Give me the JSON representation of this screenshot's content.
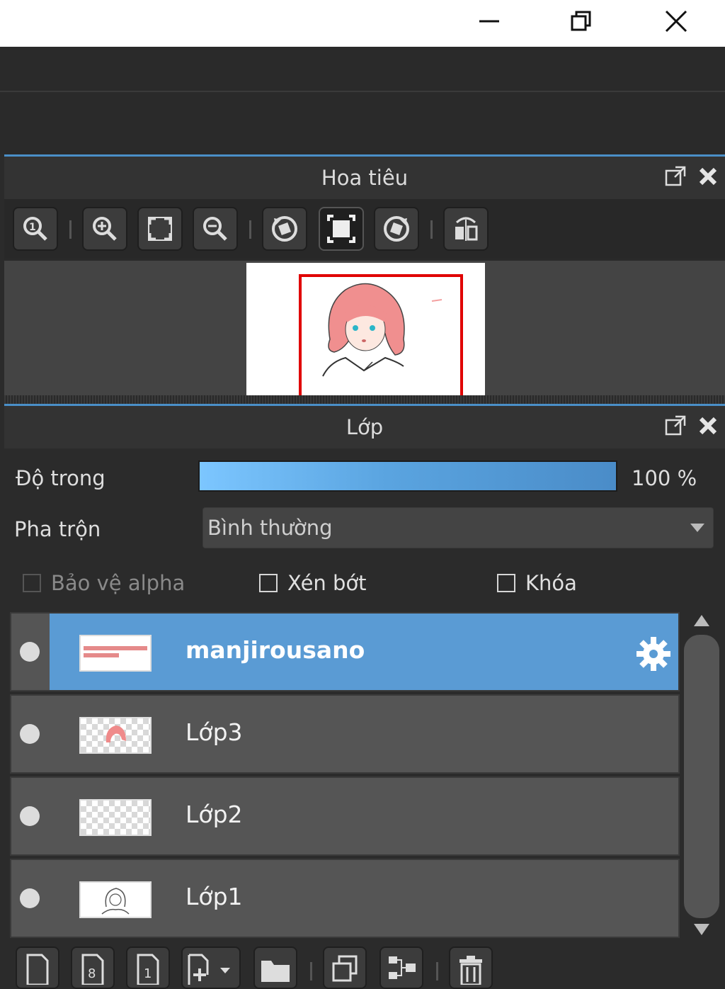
{
  "window": {
    "controls": [
      "minimize-icon",
      "restore-icon",
      "close-icon"
    ]
  },
  "navigator": {
    "title": "Hoa tiêu",
    "toolbar_icons": [
      "zoom-actual-icon",
      "zoom-in-icon",
      "fit-screen-icon",
      "zoom-out-icon",
      "rotate-left-icon",
      "fit-frame-icon",
      "rotate-right-icon",
      "flip-horizontal-icon"
    ]
  },
  "layers": {
    "title": "Lớp",
    "opacity_label": "Độ trong",
    "opacity_value": "100 %",
    "opacity_fraction": 1.0,
    "blend_label": "Pha trộn",
    "blend_value": "Bình thường",
    "checkboxes": {
      "protect_alpha": "Bảo vệ alpha",
      "clipping": "Xén bớt",
      "lock": "Khóa"
    },
    "items": [
      {
        "name": "manjirousano",
        "selected": true
      },
      {
        "name": "Lớp3",
        "selected": false
      },
      {
        "name": "Lớp2",
        "selected": false
      },
      {
        "name": "Lớp1",
        "selected": false
      }
    ],
    "bottom_toolbar_icons": [
      "new-layer-icon",
      "new-8bit-layer-icon",
      "new-1bit-layer-icon",
      "add-layer-dropdown-icon",
      "folder-icon",
      "duplicate-layer-icon",
      "merge-layer-icon",
      "delete-layer-icon"
    ]
  },
  "colors": {
    "accent": "#4a8fc8",
    "selected_row": "#5a9bd4",
    "nav_frame": "#e00000"
  }
}
